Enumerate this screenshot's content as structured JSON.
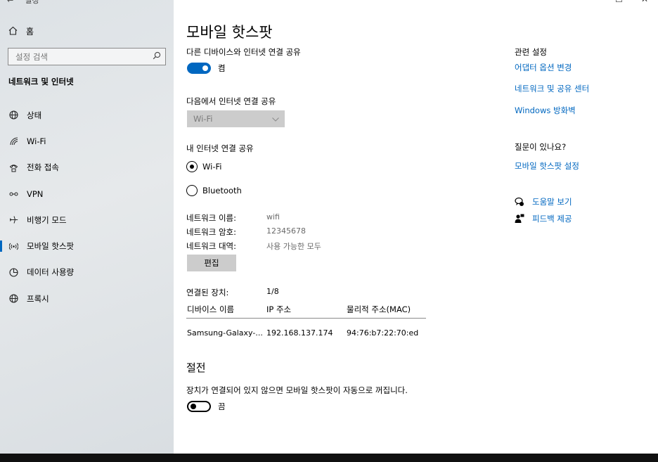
{
  "window": {
    "back_glyph": "←",
    "app_title": "설정",
    "controls": [
      "—",
      "☐",
      "✕"
    ]
  },
  "sidebar": {
    "home_label": "홈",
    "search_placeholder": "설정 검색",
    "section_title": "네트워크 및 인터넷",
    "items": [
      {
        "label": "상태",
        "icon": "globe-status-icon"
      },
      {
        "label": "Wi-Fi",
        "icon": "wifi-icon"
      },
      {
        "label": "전화 접속",
        "icon": "dialup-icon"
      },
      {
        "label": "VPN",
        "icon": "vpn-icon"
      },
      {
        "label": "비행기 모드",
        "icon": "airplane-icon"
      },
      {
        "label": "모바일 핫스팟",
        "icon": "hotspot-icon",
        "active": true
      },
      {
        "label": "데이터 사용량",
        "icon": "data-usage-icon"
      },
      {
        "label": "프록시",
        "icon": "globe-icon"
      }
    ]
  },
  "main": {
    "title": "모바일 핫스팟",
    "share_label": "다른 디바이스와 인터넷 연결 공유",
    "share_toggle": {
      "on": true,
      "text": "켬"
    },
    "share_from_label": "다음에서 인터넷 연결 공유",
    "share_from_value": "Wi-Fi",
    "share_over_label": "내 인터넷 연결 공유",
    "radio_options": [
      {
        "label": "Wi-Fi",
        "checked": true
      },
      {
        "label": "Bluetooth",
        "checked": false
      }
    ],
    "network_name_label": "네트워크 이름:",
    "network_name_value": "wifi",
    "network_password_label": "네트워크 암호:",
    "network_password_value": "12345678",
    "network_band_label": "네트워크 대역:",
    "network_band_value": "사용 가능한 모두",
    "edit_button": "편집",
    "connected_label": "연결된 장치:",
    "connected_value": "1/8",
    "table": {
      "headers": [
        "디바이스 이름",
        "IP 주소",
        "물리적 주소(MAC)"
      ],
      "rows": [
        [
          "Samsung-Galaxy-...",
          "192.168.137.174",
          "94:76:b7:22:70:ed"
        ]
      ]
    },
    "power_title": "절전",
    "power_desc": "장치가 연결되어 있지 않으면 모바일 핫스팟이 자동으로 꺼집니다.",
    "power_toggle": {
      "on": false,
      "text": "끔"
    }
  },
  "right": {
    "related_title": "관련 설정",
    "related_links": [
      "어댑터 옵션 변경",
      "네트워크 및 공유 센터",
      "Windows 방화벽"
    ],
    "question_title": "질문이 있나요?",
    "question_link": "모바일 핫스팟 설정",
    "help_label": "도움말 보기",
    "feedback_label": "피드백 제공"
  },
  "colors": {
    "accent": "#0067c0",
    "sidebar_bg": "#e2e6e9"
  }
}
